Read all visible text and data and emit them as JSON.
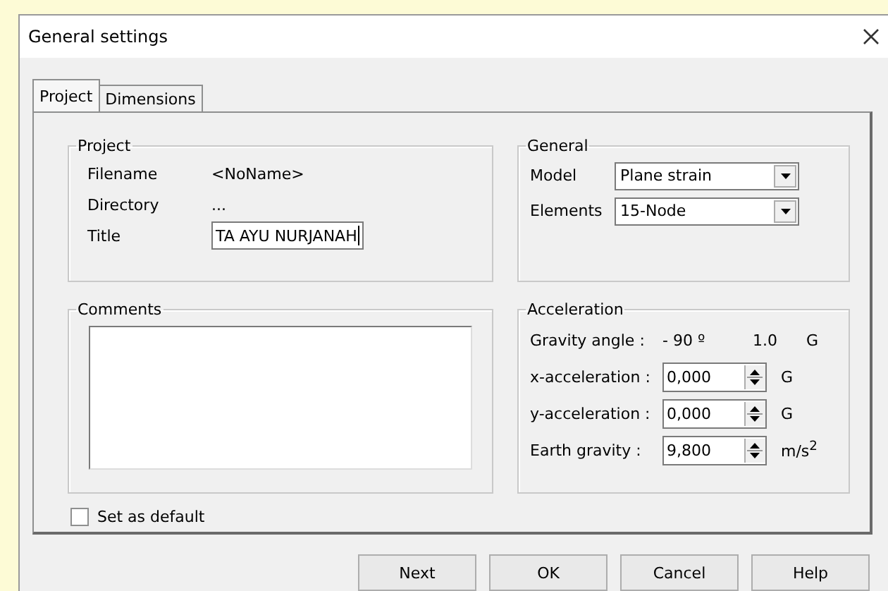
{
  "window": {
    "title": "General settings"
  },
  "tabs": [
    {
      "label": "Project",
      "selected": true
    },
    {
      "label": "Dimensions",
      "selected": false
    }
  ],
  "project": {
    "title": "Project",
    "rows": [
      {
        "kind": "text",
        "label": "Filename",
        "value": "<NoName>"
      },
      {
        "kind": "text",
        "label": "Directory",
        "value": "..."
      },
      {
        "kind": "input",
        "label": "Title",
        "value": "TA AYU NURJANAH"
      }
    ]
  },
  "comments": {
    "title": "Comments"
  },
  "general": {
    "title": "General",
    "rows": [
      {
        "label": "Model",
        "value": "Plane strain"
      },
      {
        "label": "Elements",
        "value": "15-Node"
      }
    ]
  },
  "acceleration": {
    "title": "Acceleration",
    "gravity_angle": {
      "label": "Gravity angle :",
      "angle": "- 90 º",
      "value": "1.0",
      "unit": "G"
    },
    "rows": [
      {
        "label": "x-acceleration :",
        "value": "0,000",
        "unit": "G"
      },
      {
        "label": "y-acceleration :",
        "value": "0,000",
        "unit": "G"
      },
      {
        "label": "Earth gravity :",
        "value": "9,800",
        "unit": "m/s$^{2}$"
      }
    ]
  },
  "set_as_default": {
    "label": "Set as default",
    "checked": false
  },
  "buttons": [
    "Next",
    "OK",
    "Cancel",
    "Help"
  ]
}
